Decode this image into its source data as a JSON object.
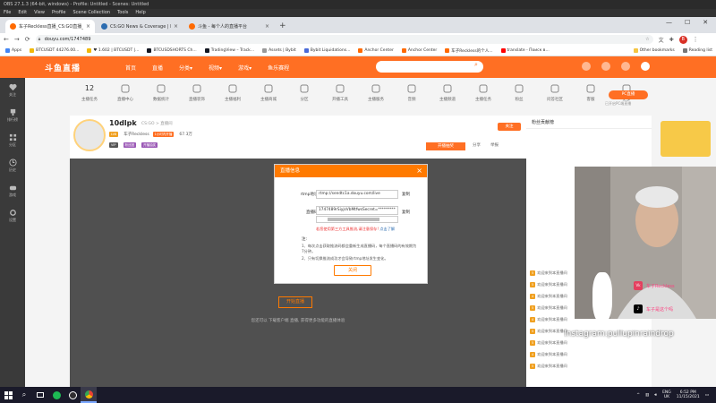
{
  "obs": {
    "title": "OBS 27.1.3 (64-bit, windows) - Profile: Untitled - Scenes: Untitled",
    "menu": [
      "File",
      "Edit",
      "View",
      "Profile",
      "Scene Collection",
      "Tools",
      "Help"
    ]
  },
  "browser": {
    "tabs": [
      {
        "label": "车子Reckless直播_CS:GO直播_斗",
        "color": "#ff6a00",
        "active": true
      },
      {
        "label": "CS:GO News & Coverage | HLTV",
        "color": "#2b6cb0",
        "active": false
      },
      {
        "label": "斗鱼 - 每个人的直播平台",
        "color": "#ff6a00",
        "active": false
      }
    ],
    "new_tab": "+",
    "url": "douyu.com/1747489",
    "profile_initial": "B",
    "bookmarks": [
      "Apps",
      "BTCUSDT 44276.00...",
      "♥ 1.602 | BTCUSDT |...",
      "BTCUSDSHORTS Ch...",
      "TradingView – Track...",
      "Assets | Bybit",
      "Bybit Liquidations...",
      "Anchor Center",
      "Anchor Center",
      "车子Reckless的个人...",
      "translate - Поиск в..."
    ],
    "bookmarks_right": [
      "Other bookmarks",
      "Reading list"
    ]
  },
  "douyu": {
    "logo": "斗鱼直播",
    "nav": [
      "首页",
      "直播",
      "分类▾",
      "视频▾",
      "游戏▾",
      "鱼乐赛程"
    ],
    "search_placeholder": "",
    "left_items": [
      "关注",
      "排行榜",
      "分区",
      "历史",
      "游戏",
      "设置"
    ],
    "categories": [
      {
        "label": "主播任务",
        "num": "12"
      },
      {
        "label": "直播中心"
      },
      {
        "label": "数据统计"
      },
      {
        "label": "直播装饰"
      },
      {
        "label": "主播福利"
      },
      {
        "label": "主播商城"
      },
      {
        "label": "分区"
      },
      {
        "label": "开播工具"
      },
      {
        "label": "主播服务"
      },
      {
        "label": "音频"
      },
      {
        "label": "主播频道"
      },
      {
        "label": "主播任务"
      },
      {
        "label": "粉丝"
      },
      {
        "label": "问答社区"
      },
      {
        "label": "客服"
      },
      {
        "label": "更多"
      }
    ],
    "pc_button": "PC直播",
    "pc_sub": "已开启PC端直播",
    "streamer": {
      "name": "10dlpk",
      "tag1": "车子Reckless",
      "tag2": "1小时内开播",
      "meta": "CS:GO > 直播间",
      "badge1": "LV6",
      "badge2": "粉丝团",
      "fans": "67.3万",
      "report": "举报",
      "share": "分享",
      "follow": "关注",
      "activity": "开播抽奖"
    },
    "video": {
      "start_button": "开始直播",
      "hint": "您还可以 下载客户端 直播, 获得更多功能的直播体验",
      "hint_link": "下载客户端"
    },
    "dialog": {
      "title": "直播信息",
      "rtmp_label": "rtmp地址:",
      "rtmp_value": "rtmp://sendtc1a.douyu.com/live",
      "key_label": "直播码:",
      "key_value": "1747489rSiyjsVbMtfwsSecret=*********",
      "copy": "复制",
      "warn": "若您使用第三方工具推流,请注意保存!",
      "warn_link": "点击了解",
      "notes_title": "注:",
      "notes": [
        "1、每次点击获取推流码都会重新生成直播码，每个直播码的有效期为7分钟。",
        "2、只有切换推流成功才会导致rtmp地址发生变化。"
      ],
      "close": "关闭"
    },
    "rank_title": "粉丝贡献榜",
    "chat": [
      {
        "badge": "5",
        "text": "欢迎来到本直播间"
      },
      {
        "badge": "5",
        "text": "欢迎来到本直播间"
      },
      {
        "badge": "4",
        "text": "欢迎来到本直播间"
      },
      {
        "badge": "5",
        "text": "欢迎来到本直播间"
      },
      {
        "badge": "4",
        "text": "欢迎来到本直播间"
      },
      {
        "badge": "5",
        "text": "欢迎来到本直播间"
      },
      {
        "badge": "5",
        "text": "欢迎来到本直播间"
      },
      {
        "badge": "4",
        "text": "欢迎来到本直播间"
      },
      {
        "badge": "5",
        "text": "欢迎来到本直播间"
      }
    ]
  },
  "webcam": {
    "vk_text": "车子Reckless",
    "tiktok_text": "车子是这个吗",
    "instagram": "Instagram:pullupinraindrop"
  },
  "taskbar": {
    "lang1": "ENG",
    "lang2": "UK",
    "time": "6:52 PM",
    "date": "11/15/2021"
  },
  "colors": {
    "accent": "#ff7a00",
    "nav": "#ff6f23"
  }
}
